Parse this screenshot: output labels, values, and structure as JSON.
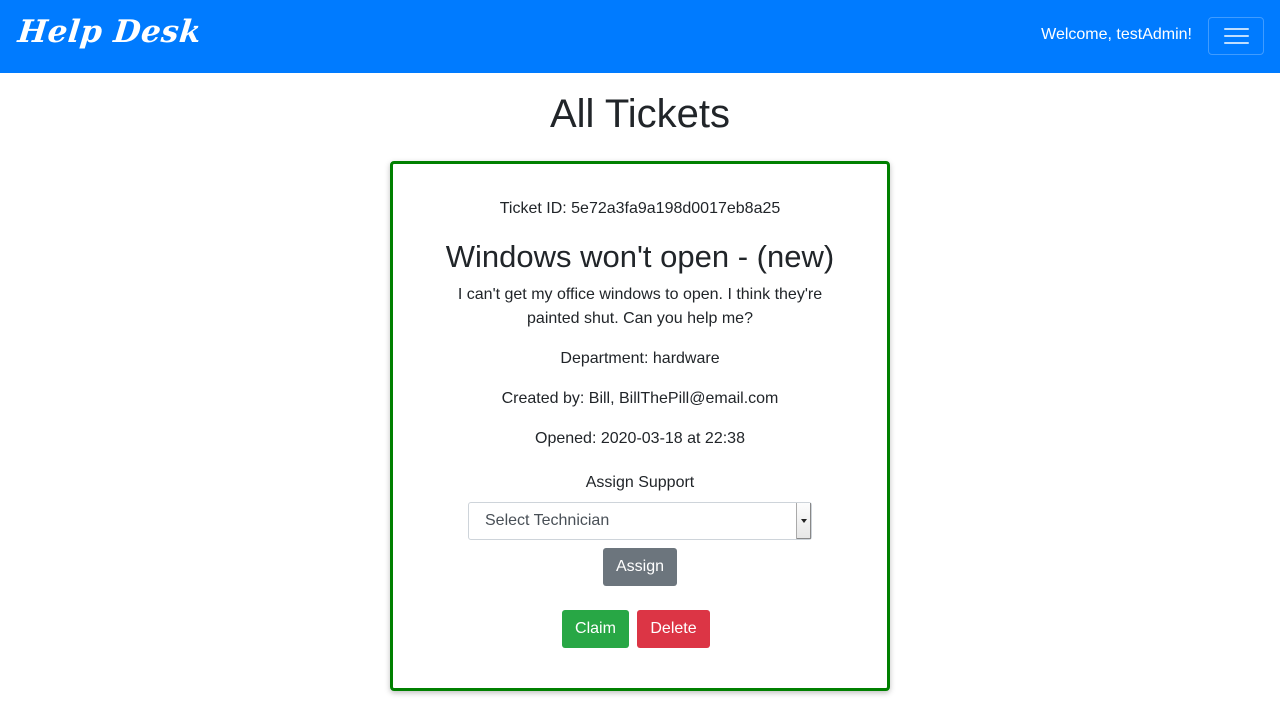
{
  "navbar": {
    "brand": "Help Desk",
    "welcome": "Welcome, testAdmin!",
    "toggle_icon": "hamburger-menu-icon"
  },
  "page": {
    "title": "All Tickets"
  },
  "ticket": {
    "id_line": "Ticket ID: 5e72a3fa9a198d0017eb8a25",
    "title": "Windows won't open - (new)",
    "description": "I can't get my office windows to open. I think they're painted shut. Can you help me?",
    "department": "Department: hardware",
    "created_by": "Created by: Bill, BillThePill@email.com",
    "opened": "Opened: 2020-03-18 at 22:38",
    "assign_label": "Assign Support",
    "technician_select": "Select Technician",
    "assign_button": "Assign",
    "claim_button": "Claim",
    "delete_button": "Delete"
  },
  "colors": {
    "navbar": "#007bff",
    "card_border": "#008000",
    "assign": "#6c757d",
    "claim": "#28a745",
    "delete": "#dc3545"
  }
}
